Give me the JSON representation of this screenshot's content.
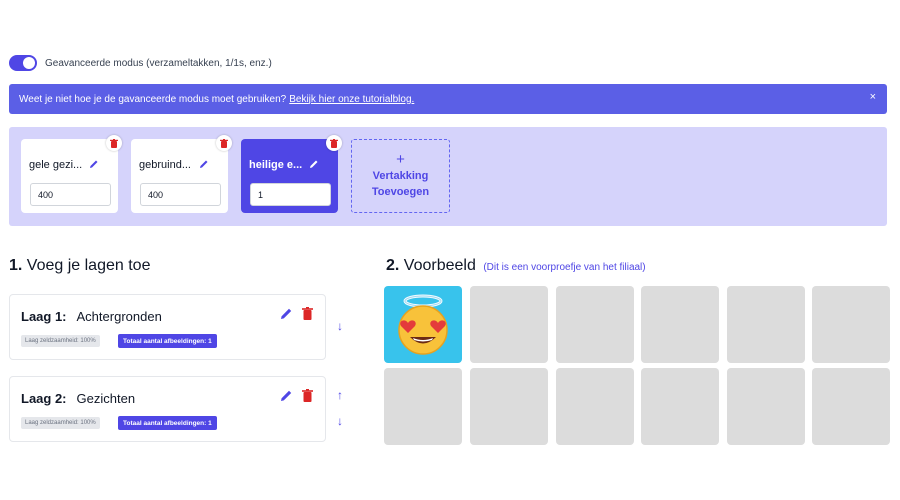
{
  "advanced_mode": {
    "label": "Geavanceerde modus (verzameltakken, 1/1s, enz.)",
    "enabled": true
  },
  "banner": {
    "text": "Weet je niet hoe je de gavanceerde modus moet gebruiken?",
    "link": "Bekijk hier onze tutorialblog.",
    "close": "×"
  },
  "branches": [
    {
      "name": "gele gezi...",
      "value": "400",
      "active": false
    },
    {
      "name": "gebruind...",
      "value": "400",
      "active": false
    },
    {
      "name": "heilige e...",
      "value": "1",
      "active": true
    }
  ],
  "add_branch": {
    "plus": "+",
    "label": "Vertakking Toevoegen"
  },
  "layers_section": {
    "num": "1.",
    "title": "Voeg je lagen toe"
  },
  "preview_section": {
    "num": "2.",
    "title": "Voorbeeld",
    "subtitle": "(Dit is een voorproefje van het filiaal)"
  },
  "layers": [
    {
      "label": "Laag 1:",
      "name": "Achtergronden",
      "rarity": "Laag zeldzaamheid: 100%",
      "total": "Totaal aantal afbeeldingen: 1"
    },
    {
      "label": "Laag 2:",
      "name": "Gezichten",
      "rarity": "Laag zeldzaamheid: 100%",
      "total": "Totaal aantal afbeeldingen: 1"
    }
  ],
  "arrows": {
    "up": "↑",
    "down": "↓"
  },
  "colors": {
    "accent": "#4f46e5",
    "banner": "#5b5fe6",
    "branch_bg": "#d5d3fb",
    "delete": "#dc2626",
    "tile_empty": "#dcdcdc",
    "tile_preview": "#38c3ec"
  },
  "preview": {
    "tile_count": 12,
    "first_tile_icon": "heart-eyes-halo-emoji"
  }
}
